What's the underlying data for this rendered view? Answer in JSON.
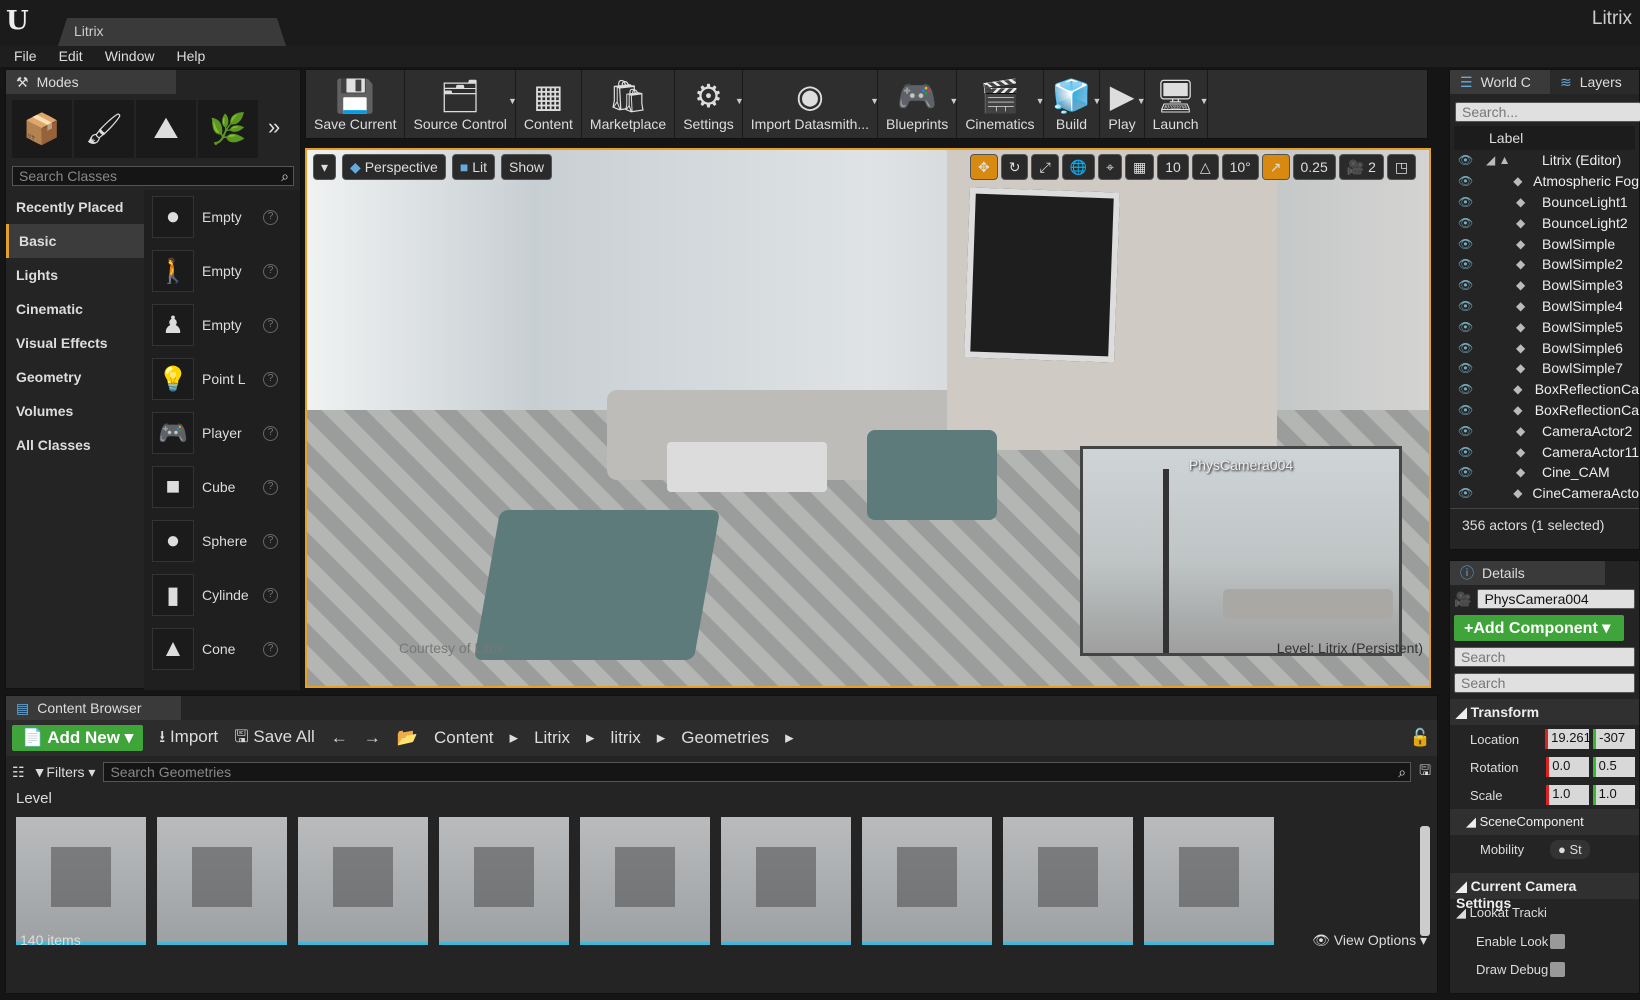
{
  "window": {
    "tab": "Litrix",
    "title": "Litrix"
  },
  "menu": [
    "File",
    "Edit",
    "Window",
    "Help"
  ],
  "modes": {
    "tab": "Modes",
    "search_placeholder": "Search Classes",
    "categories": [
      "Recently Placed",
      "Basic",
      "Lights",
      "Cinematic",
      "Visual Effects",
      "Geometry",
      "Volumes",
      "All Classes"
    ],
    "selected": "Basic",
    "items": [
      {
        "label": "Empty",
        "icon": "sphere-icon"
      },
      {
        "label": "Empty",
        "icon": "character-icon"
      },
      {
        "label": "Empty",
        "icon": "pawn-icon"
      },
      {
        "label": "Point L",
        "icon": "lightbulb-icon"
      },
      {
        "label": "Player",
        "icon": "player-start-icon"
      },
      {
        "label": "Cube",
        "icon": "cube-icon"
      },
      {
        "label": "Sphere",
        "icon": "sphere-icon"
      },
      {
        "label": "Cylinde",
        "icon": "cylinder-icon"
      },
      {
        "label": "Cone",
        "icon": "cone-icon"
      }
    ]
  },
  "toolbar": [
    {
      "label": "Save Current",
      "icon": "💾",
      "dd": false
    },
    {
      "label": "Source Control",
      "icon": "🗂",
      "dd": true
    },
    {
      "label": "Content",
      "icon": "▦",
      "dd": false
    },
    {
      "label": "Marketplace",
      "icon": "🛍",
      "dd": false
    },
    {
      "label": "Settings",
      "icon": "⚙",
      "dd": true
    },
    {
      "label": "Import Datasmith...",
      "icon": "◉",
      "dd": true
    },
    {
      "label": "Blueprints",
      "icon": "🎮",
      "dd": true
    },
    {
      "label": "Cinematics",
      "icon": "🎬",
      "dd": true
    },
    {
      "label": "Build",
      "icon": "🧊",
      "dd": true
    },
    {
      "label": "Play",
      "icon": "▶",
      "dd": true
    },
    {
      "label": "Launch",
      "icon": "🖥",
      "dd": true
    }
  ],
  "viewport": {
    "perspective": "Perspective",
    "lit": "Lit",
    "show": "Show",
    "grid": "10",
    "angle": "10°",
    "scale": "0.25",
    "speed": "2",
    "pip_title": "PhysCamera004",
    "watermark": "Courtesy of Litrix",
    "level": "Level:  Litrix (Persistent)"
  },
  "content_browser": {
    "tab": "Content Browser",
    "add_new": "Add New",
    "import": "Import",
    "save_all": "Save All",
    "path": [
      "Content",
      "Litrix",
      "litrix",
      "Geometries"
    ],
    "filters": "Filters",
    "search_placeholder": "Search Geometries",
    "level_chip": "Level",
    "count": "140 items",
    "view_options": "View Options"
  },
  "outliner": {
    "tab": "World C",
    "tab2": "Layers",
    "search_placeholder": "Search...",
    "column": "Label",
    "items": [
      "Litrix (Editor)",
      "Atmospheric Fog",
      "BounceLight1",
      "BounceLight2",
      "BowlSimple",
      "BowlSimple2",
      "BowlSimple3",
      "BowlSimple4",
      "BowlSimple5",
      "BowlSimple6",
      "BowlSimple7",
      "BoxReflectionCa",
      "BoxReflectionCa",
      "CameraActor2",
      "CameraActor11",
      "Cine_CAM",
      "CineCameraActo"
    ],
    "status": "356 actors (1 selected)"
  },
  "details": {
    "tab": "Details",
    "name": "PhysCamera004",
    "add_component": "Add Component",
    "search1": "Search",
    "search2": "Search",
    "transform": "Transform",
    "location_label": "Location",
    "location": [
      "19.261",
      "-307"
    ],
    "rotation_label": "Rotation",
    "rotation": [
      "0.0",
      "0.5"
    ],
    "scale_label": "Scale",
    "scale": [
      "1.0",
      "1.0"
    ],
    "scene_component": "SceneComponent",
    "mobility": "Mobility",
    "mobility_value": "St",
    "camera_settings": "Current Camera Settings",
    "lookat": "Lookat Tracki",
    "enable_look": "Enable Look",
    "draw_debug": "Draw Debug"
  },
  "colors": {
    "accent": "#e8a020",
    "green": "#3fa43a",
    "asset_underline": "#3fb7d5"
  }
}
